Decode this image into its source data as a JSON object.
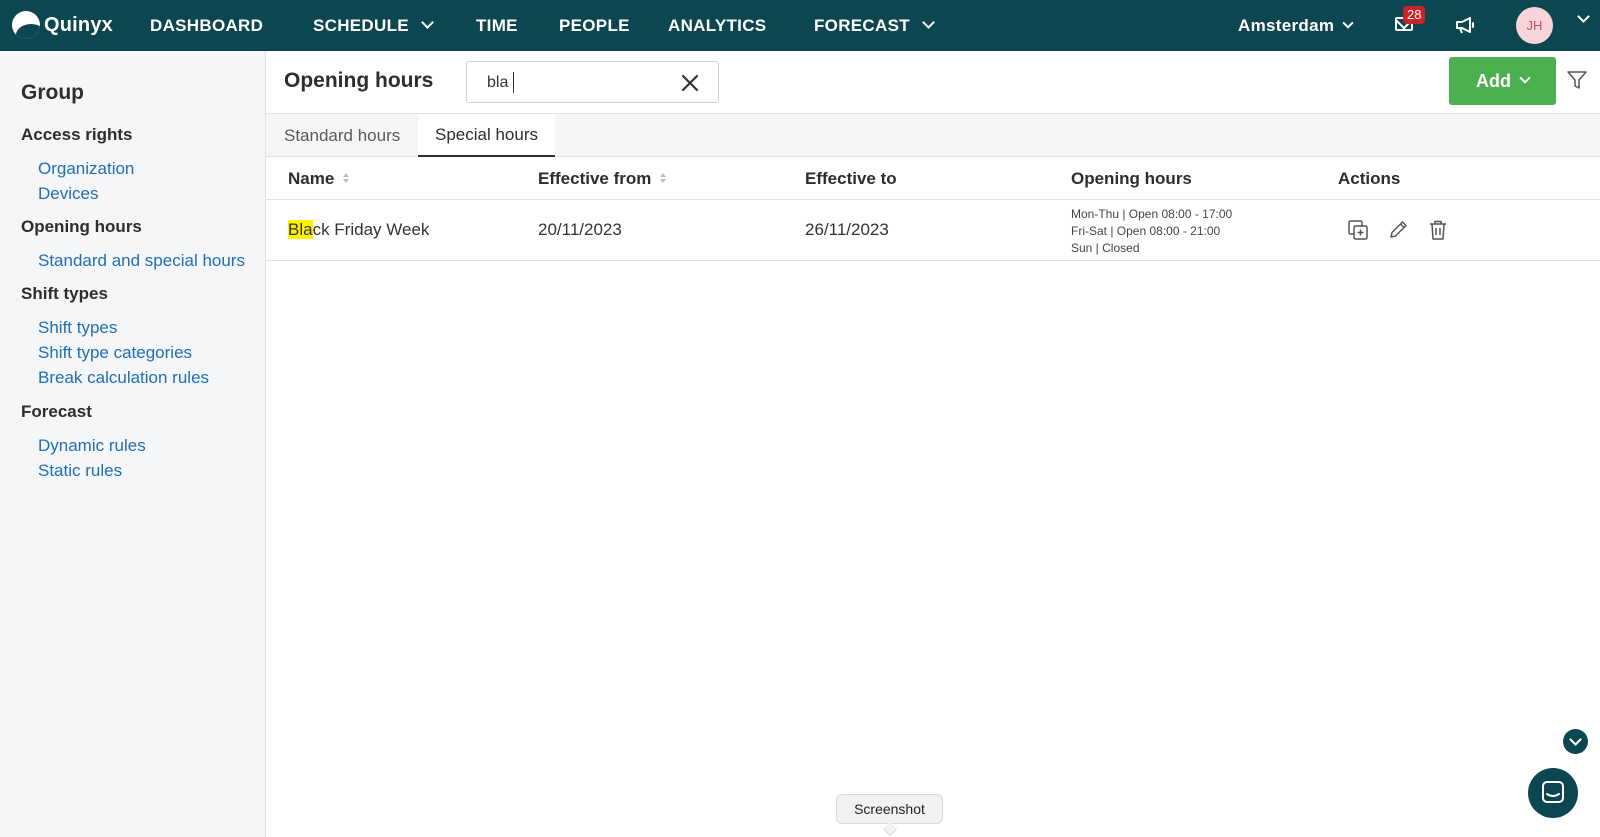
{
  "brand": {
    "name": "Quinyx"
  },
  "topnav": {
    "items": [
      {
        "label": "DASHBOARD"
      },
      {
        "label": "SCHEDULE"
      },
      {
        "label": "TIME"
      },
      {
        "label": "PEOPLE"
      },
      {
        "label": "ANALYTICS"
      },
      {
        "label": "FORECAST"
      }
    ],
    "location": "Amsterdam",
    "notifications_count": "28",
    "avatar_initials": "JH"
  },
  "sidebar": {
    "title": "Group",
    "sections": [
      {
        "label": "Access rights",
        "links": [
          "Organization",
          "Devices"
        ]
      },
      {
        "label": "Opening hours",
        "links": [
          "Standard and special hours"
        ]
      },
      {
        "label": "Shift types",
        "links": [
          "Shift types",
          "Shift type categories",
          "Break calculation rules"
        ]
      },
      {
        "label": "Forecast",
        "links": [
          "Dynamic rules",
          "Static rules"
        ]
      }
    ]
  },
  "main": {
    "title": "Opening hours",
    "search": {
      "value": "bla",
      "placeholder": ""
    },
    "add_label": "Add",
    "tabs": [
      {
        "label": "Standard hours"
      },
      {
        "label": "Special hours"
      }
    ],
    "table": {
      "columns": [
        "Name",
        "Effective from",
        "Effective to",
        "Opening hours",
        "Actions"
      ],
      "rows": [
        {
          "name_highlight": "Bla",
          "name_rest": "ck Friday Week",
          "effective_from": "20/11/2023",
          "effective_to": "26/11/2023",
          "hours": [
            "Mon-Thu | Open 08:00 - 17:00",
            "Fri-Sat | Open 08:00 - 21:00",
            "Sun | Closed"
          ]
        }
      ]
    }
  },
  "tooltip": "Screenshot",
  "colors": {
    "nav": "#0c4650",
    "accent": "#4caf50",
    "link": "#1f6fb2",
    "highlight": "#fff200",
    "badge": "#c9232b"
  },
  "icons": [
    "quinyx-logo-icon",
    "mail-icon",
    "megaphone-icon",
    "clear-icon",
    "filter-icon",
    "duplicate-icon",
    "edit-icon",
    "delete-icon",
    "chat-icon",
    "scroll-down-icon"
  ]
}
